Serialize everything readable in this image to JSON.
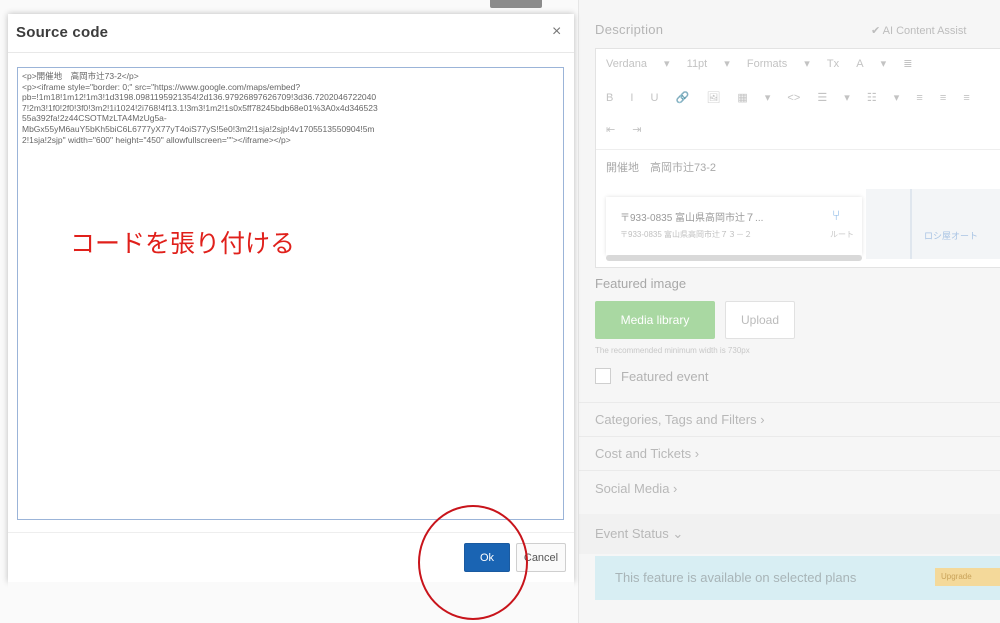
{
  "dialog": {
    "title": "Source code",
    "close_icon": "×",
    "code_lines": [
      "<p>開催地　高岡市辻73-2</p>",
      "<p><iframe style=\"border: 0;\" src=\"https://www.google.com/maps/embed?",
      "pb=!1m18!1m12!1m3!1d3198.0981195921354!2d136.97926897626709!3d36.7202046722040",
      "7!2m3!1f0!2f0!3f0!3m2!1i1024!2i768!4f13.1!3m3!1m2!1s0x5ff78245bdb68e01%3A0x4d346523",
      "55a392fa!2z44CSOTMzLTA4MzUg5a-",
      "MbGx55yM6auY5bKh5biC6L6777yX77yT4oiS77yS!5e0!3m2!1sja!2sjp!4v1705513550904!5m",
      "2!1sja!2sjp\" width=\"600\" height=\"450\" allowfullscreen=\"\"></iframe></p>"
    ],
    "annotation": "コードを張り付ける",
    "ok_label": "Ok",
    "cancel_label": "Cancel"
  },
  "editor": {
    "description_label": "Description",
    "ai_assist_label": "✔ AI Content Assist",
    "toolbar_row1": [
      "Verdana",
      "▾",
      "11pt",
      "▾",
      "Formats",
      "▾",
      "Tx",
      "A",
      "▾",
      "≣"
    ],
    "toolbar_row2": [
      "B",
      "I",
      "U",
      "🔗",
      "🖼",
      "▦",
      "▾",
      "<>",
      "☰",
      "▾",
      "☷",
      "▾",
      "≡",
      "≡",
      "≡"
    ],
    "toolbar_row3": [
      "⇤",
      "⇥"
    ],
    "body_text": "開催地　高岡市辻73-2",
    "map": {
      "address1": "〒933-0835 富山県高岡市辻７...",
      "address2": "〒933-0835 富山県高岡市辻７３－２",
      "route_label": "ルート",
      "map_link": "ロシ屋オート"
    }
  },
  "featured": {
    "label": "Featured image",
    "media_library": "Media library",
    "upload": "Upload",
    "recommend": "The recommended minimum width is 730px",
    "featured_event": "Featured event"
  },
  "sections": {
    "categories": "Categories, Tags and Filters ›",
    "cost": "Cost and Tickets ›",
    "social": "Social Media ›",
    "event_status": "Event Status ⌄"
  },
  "plan": {
    "text": "This feature is available on selected plans",
    "badge": "Upgrade"
  }
}
